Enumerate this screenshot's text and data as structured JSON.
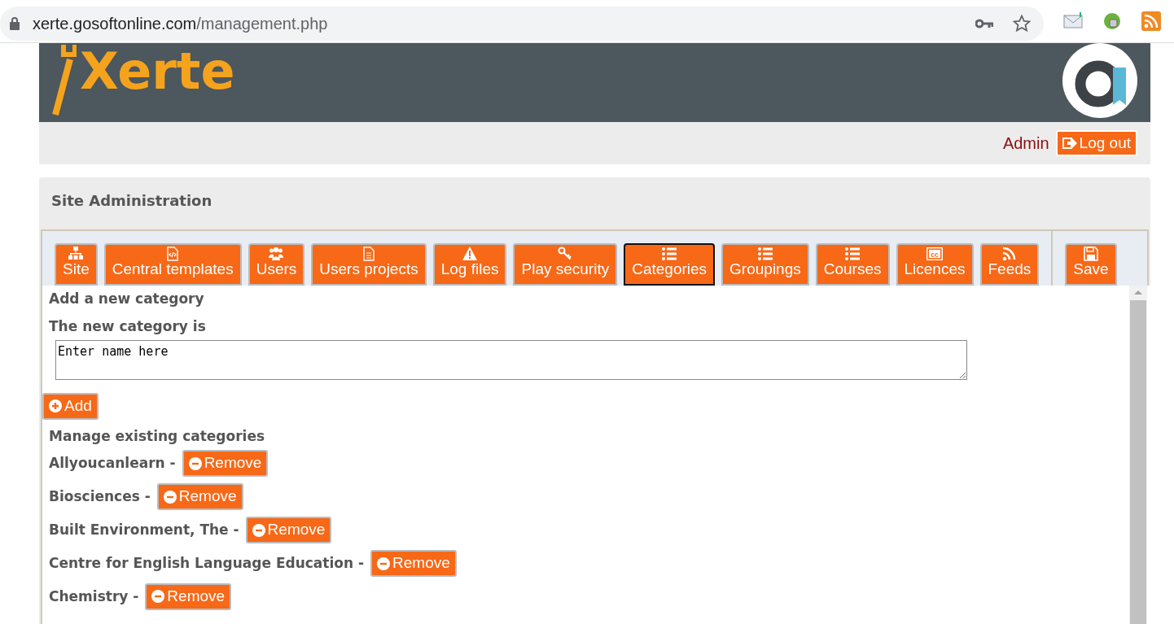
{
  "browser": {
    "url_host": "xerte.gosoftonline.com",
    "url_path": "/management.php"
  },
  "header": {
    "logo": "Xerte"
  },
  "userbar": {
    "user": "Admin",
    "logout": "Log out"
  },
  "panel": {
    "title": "Site Administration"
  },
  "tabs": [
    {
      "label": "Site",
      "kind": "sitemap",
      "selected": false
    },
    {
      "label": "Central templates",
      "kind": "code-file",
      "selected": false
    },
    {
      "label": "Users",
      "kind": "users",
      "selected": false
    },
    {
      "label": "Users projects",
      "kind": "file",
      "selected": false
    },
    {
      "label": "Log files",
      "kind": "warning",
      "selected": false
    },
    {
      "label": "Play security",
      "kind": "key",
      "selected": false
    },
    {
      "label": "Categories",
      "kind": "list",
      "selected": true
    },
    {
      "label": "Groupings",
      "kind": "list",
      "selected": false
    },
    {
      "label": "Courses",
      "kind": "list",
      "selected": false
    },
    {
      "label": "Licences",
      "kind": "cc",
      "selected": false
    },
    {
      "label": "Feeds",
      "kind": "rss",
      "selected": false
    }
  ],
  "save": {
    "label": "Save"
  },
  "content": {
    "add_heading": "Add a new category",
    "field_label": "The new category is",
    "field_value": "Enter name here",
    "add_button": "Add",
    "manage_heading": "Manage existing categories",
    "categories": [
      {
        "name": "Allyoucanlearn -",
        "button": "Remove"
      },
      {
        "name": "Biosciences -",
        "button": "Remove"
      },
      {
        "name": "Built Environment, The -",
        "button": "Remove"
      },
      {
        "name": "Centre for English Language Education -",
        "button": "Remove"
      },
      {
        "name": "Chemistry -",
        "button": "Remove"
      }
    ]
  }
}
